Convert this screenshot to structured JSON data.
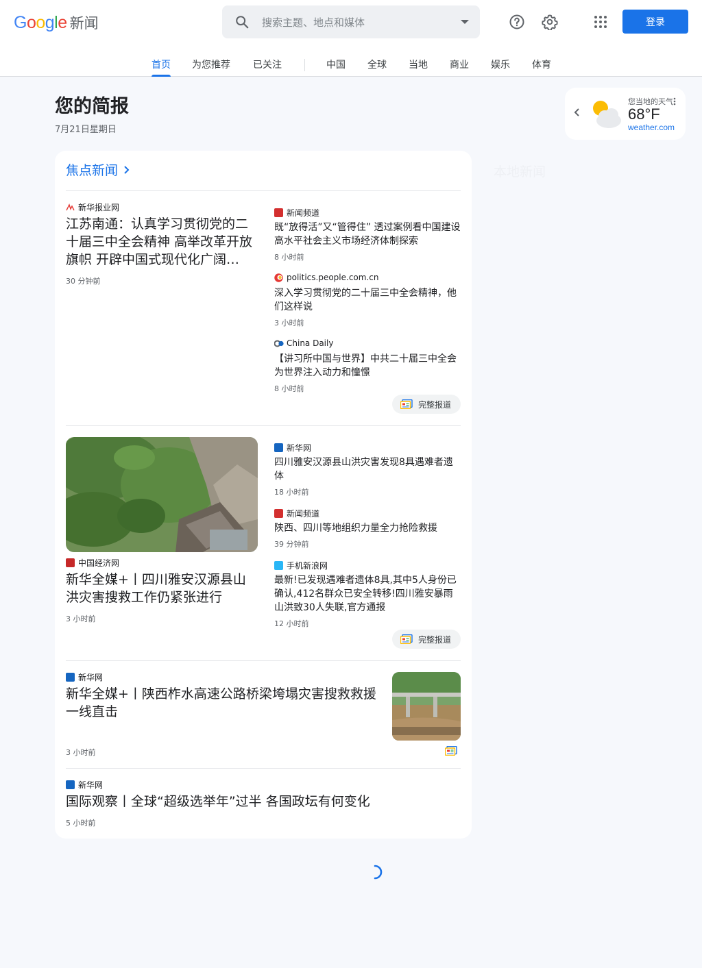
{
  "header": {
    "logo_text": "Google",
    "logo_suffix": "新闻",
    "search_placeholder": "搜索主题、地点和媒体",
    "login_label": "登录"
  },
  "tabs": [
    {
      "label": "首页",
      "active": true
    },
    {
      "label": "为您推荐"
    },
    {
      "label": "已关注"
    },
    {
      "label": "中国"
    },
    {
      "label": "全球"
    },
    {
      "label": "当地"
    },
    {
      "label": "商业"
    },
    {
      "label": "娱乐"
    },
    {
      "label": "体育"
    }
  ],
  "briefing": {
    "title": "您的简报",
    "date": "7月21日星期日"
  },
  "weather": {
    "label": "您当地的天气",
    "temp": "68°F",
    "source": "weather.com"
  },
  "local_news_label": "本地新闻",
  "top_stories": {
    "heading": "焦点新闻",
    "full_coverage_label": "完整报道",
    "clusters": [
      {
        "main": {
          "source": "新华报业网",
          "title": "江苏南通：认真学习贯彻党的二十届三中全会精神 高举改革开放旗帜 开辟中国式现代化广阔…",
          "time": "30 分钟前"
        },
        "related": [
          {
            "source": "新闻频道",
            "title": "既“放得活”又“管得住” 透过案例看中国建设高水平社会主义市场经济体制探索",
            "time": "8 小时前"
          },
          {
            "source": "politics.people.com.cn",
            "title": "深入学习贯彻党的二十届三中全会精神，他们这样说",
            "time": "3 小时前"
          },
          {
            "source": "China Daily",
            "title": "【讲习所中国与世界】中共二十届三中全会为世界注入动力和憧憬",
            "time": "8 小时前"
          }
        ]
      },
      {
        "main": {
          "source": "中国经济网",
          "title": "新华全媒+丨四川雅安汉源县山洪灾害搜救工作仍紧张进行",
          "time": "3 小时前"
        },
        "related": [
          {
            "source": "新华网",
            "title": "四川雅安汉源县山洪灾害发现8具遇难者遗体",
            "time": "18 小时前"
          },
          {
            "source": "新闻频道",
            "title": "陕西、四川等地组织力量全力抢险救援",
            "time": "39 分钟前"
          },
          {
            "source": "手机新浪网",
            "title": "最新!已发现遇难者遗体8具,其中5人身份已确认,412名群众已安全转移!四川雅安暴雨山洪致30人失联,官方通报",
            "time": "12 小时前"
          }
        ]
      },
      {
        "main": {
          "source": "新华网",
          "title": "新华全媒+丨陕西柞水高速公路桥梁垮塌灾害搜救救援一线直击",
          "time": "3 小时前"
        }
      },
      {
        "main": {
          "source": "新华网",
          "title": "国际观察丨全球“超级选举年”过半 各国政坛有何变化",
          "time": "5 小时前"
        }
      }
    ]
  },
  "colors": {
    "accent": "#1a73e8",
    "background": "#f6f8fc"
  }
}
